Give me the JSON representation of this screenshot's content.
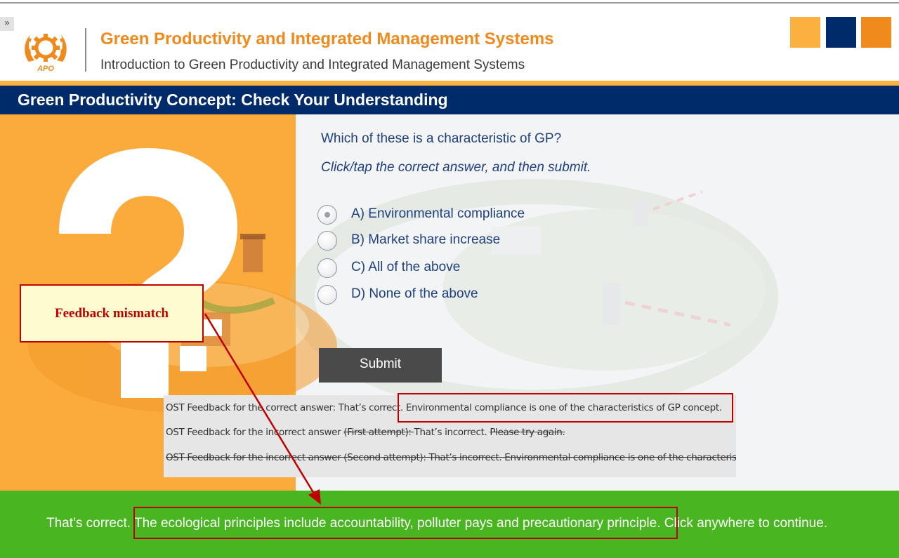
{
  "header": {
    "expand_glyph": "»",
    "logo_text": "APO",
    "course_title": "Green Productivity and Integrated Management Systems",
    "course_subtitle": "Introduction to Green Productivity and Integrated Management Systems",
    "accent_colors": [
      "#fbb040",
      "#002b6b",
      "#f08a1c"
    ]
  },
  "slide": {
    "title": "Green Productivity Concept: Check Your Understanding"
  },
  "quiz": {
    "question": "Which of these is a characteristic of GP?",
    "instruction": "Click/tap the correct answer, and then submit.",
    "options": [
      {
        "label": "A) Environmental compliance",
        "selected": true
      },
      {
        "label": "B) Market share increase",
        "selected": false
      },
      {
        "label": "C) All of the above",
        "selected": false
      },
      {
        "label": "D)  None of the above",
        "selected": false
      }
    ],
    "submit_label": "Submit"
  },
  "feedback_notes": {
    "line1": "OST Feedback for the correct answer: That’s correct. Environmental compliance is one of the characteristics of GP concept.",
    "line2_prefix": "OST Feedback for the incorrect answer ",
    "line2_struck": "(First attempt): ",
    "line2_mid": "That’s incorrect. ",
    "line2_struck_end": "Please try again.",
    "line3": "OST Feedback for the incorrect answer (Second attempt): That’s incorrect. Environmental compliance is one of the characteristics of GP concept."
  },
  "result_bar": {
    "text": "That’s correct. The ecological principles include accountability, polluter pays and precautionary principle. Click anywhere to continue."
  },
  "annotation": {
    "callout_text": "Feedback mismatch",
    "color": "#c00000"
  },
  "colors": {
    "navy": "#002b6b",
    "orange": "#f08a1c",
    "light_orange": "#fbb040",
    "green": "#48b521",
    "text_blue": "#1f3f7d"
  }
}
